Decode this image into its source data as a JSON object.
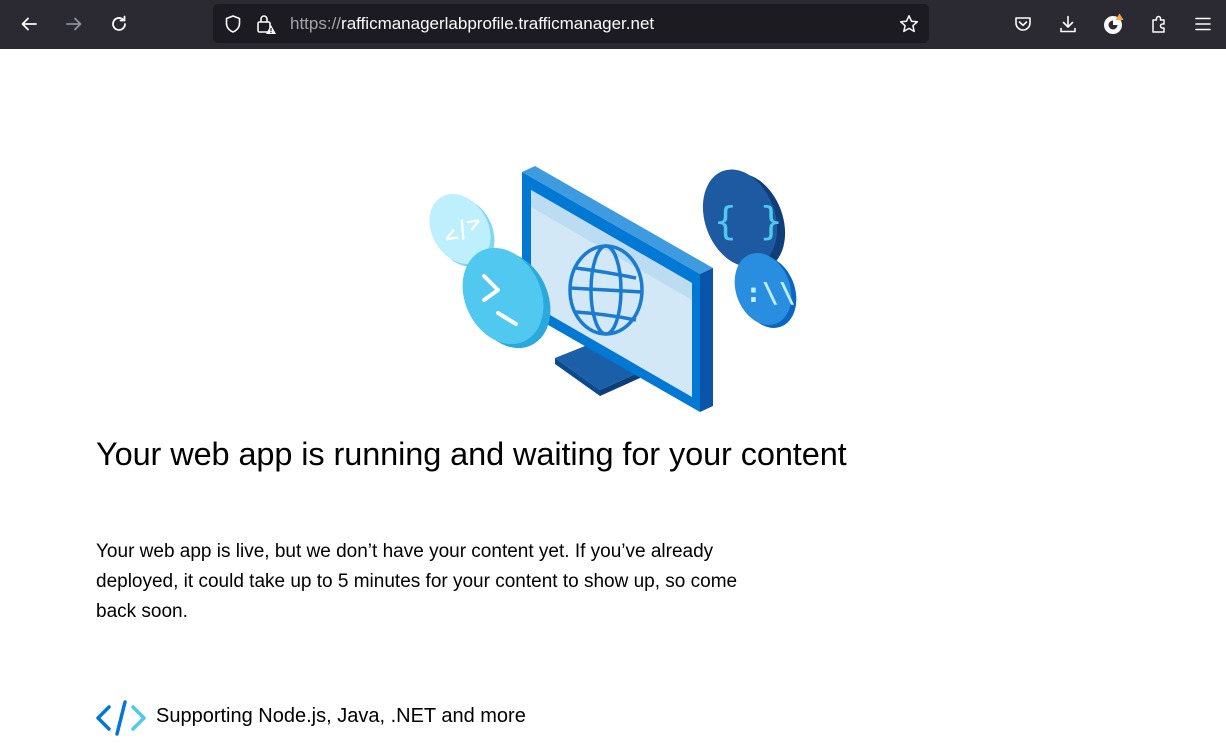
{
  "browser": {
    "url_scheme": "https://",
    "url_host": "rafficmanagerlabprofile.trafficmanager.net",
    "icons": [
      "back-arrow-icon",
      "forward-arrow-icon",
      "reload-icon",
      "tracking-shield-icon",
      "insecure-lock-icon",
      "bookmark-star-icon",
      "pocket-icon",
      "download-icon",
      "account-icon",
      "extensions-icon",
      "menu-icon"
    ]
  },
  "page": {
    "headline": "Your web app is running and waiting for your content",
    "description": "Your web app is live, but we don’t have your content yet. If you’ve already deployed, it could take up to 5 minutes for your content to show up, so come back soon.",
    "features": [
      {
        "icon": "code-brackets-icon",
        "label": "Supporting Node.js, Java, .NET and more"
      }
    ],
    "illustration": [
      "monitor-globe-icon",
      "code-tag-bubble-icon",
      "terminal-prompt-bubble-icon",
      "curly-braces-bubble-icon",
      "slashes-bubble-icon"
    ]
  },
  "colors": {
    "toolbar_bg": "#2b2a33",
    "urlbar_bg": "#1c1b22",
    "accent_blue": "#0078d4",
    "light_blue": "#50c8f0"
  }
}
